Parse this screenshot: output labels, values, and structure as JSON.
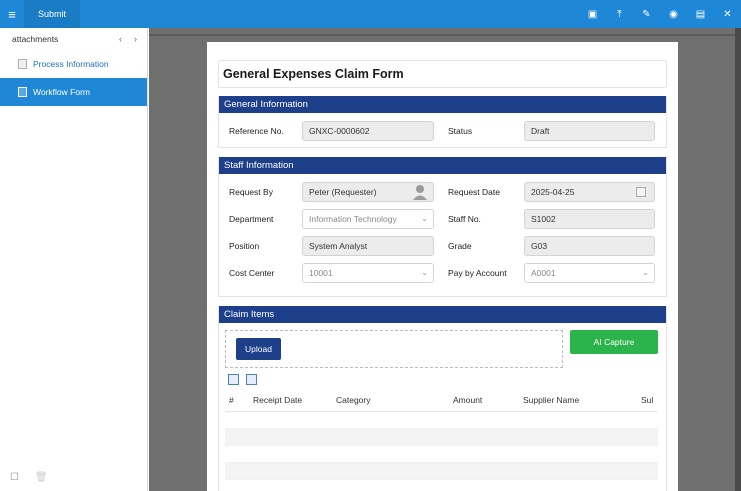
{
  "topbar": {
    "menu_icon": "hamburger-icon",
    "submit_label": "Submit",
    "icons": [
      "maximize-icon",
      "pin-icon",
      "attachment-icon",
      "eye-icon",
      "export-icon",
      "close-icon"
    ]
  },
  "sidebar": {
    "header": "attachments",
    "items": [
      {
        "label": "Process Information",
        "icon": "document-icon",
        "active": false
      },
      {
        "label": "Workflow Form",
        "icon": "form-icon",
        "active": true
      }
    ]
  },
  "form": {
    "title": "General Expenses Claim Form",
    "general": {
      "heading": "General Information",
      "reference_label": "Reference No.",
      "reference_value": "GNXC-0000602",
      "status_label": "Status",
      "status_value": "Draft"
    },
    "staff": {
      "heading": "Staff Information",
      "request_by_label": "Request By",
      "request_by_value": "Peter (Requester)",
      "request_date_label": "Request Date",
      "request_date_value": "2025-04-25",
      "department_label": "Department",
      "department_value": "Information Technology",
      "staff_no_label": "Staff No.",
      "staff_no_value": "S1002",
      "position_label": "Position",
      "position_value": "System Analyst",
      "grade_label": "Grade",
      "grade_value": "G03",
      "cost_center_label": "Cost Center",
      "cost_center_value": "10001",
      "pay_by_label": "Pay by Account",
      "pay_by_value": "A0001"
    },
    "claims": {
      "heading": "Claim Items",
      "upload_label": "Upload",
      "ai_label": "AI Capture",
      "columns": [
        "#",
        "Receipt Date",
        "Category",
        "Amount",
        "Supplier Name",
        "Sul"
      ]
    }
  }
}
